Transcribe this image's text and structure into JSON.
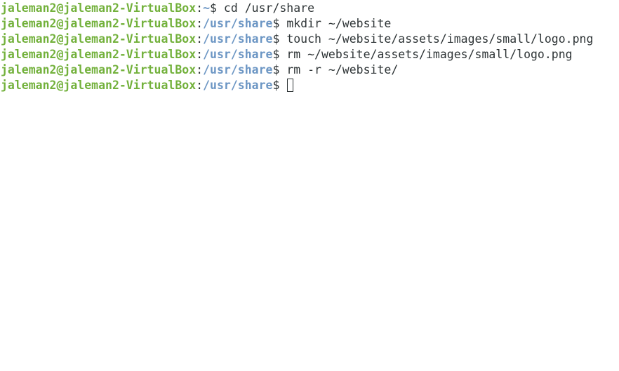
{
  "terminal": {
    "lines": [
      {
        "user": "jaleman2@jaleman2-VirtualBox",
        "colon": ":",
        "path": "~",
        "dollar": "$ ",
        "cmd": "cd /usr/share"
      },
      {
        "user": "jaleman2@jaleman2-VirtualBox",
        "colon": ":",
        "path": "/usr/share",
        "dollar": "$ ",
        "cmd": "mkdir ~/website"
      },
      {
        "user": "jaleman2@jaleman2-VirtualBox",
        "colon": ":",
        "path": "/usr/share",
        "dollar": "$ ",
        "cmd": "touch ~/website/assets/images/small/logo.png"
      },
      {
        "user": "jaleman2@jaleman2-VirtualBox",
        "colon": ":",
        "path": "/usr/share",
        "dollar": "$ ",
        "cmd": "rm ~/website/assets/images/small/logo.png"
      },
      {
        "user": "jaleman2@jaleman2-VirtualBox",
        "colon": ":",
        "path": "/usr/share",
        "dollar": "$ ",
        "cmd": "rm -r ~/website/"
      },
      {
        "user": "jaleman2@jaleman2-VirtualBox",
        "colon": ":",
        "path": "/usr/share",
        "dollar": "$ ",
        "cmd": ""
      }
    ]
  },
  "colors": {
    "user": "#73b13c",
    "path": "#6c96c4",
    "text": "#2e3436",
    "background": "#ffffff"
  }
}
